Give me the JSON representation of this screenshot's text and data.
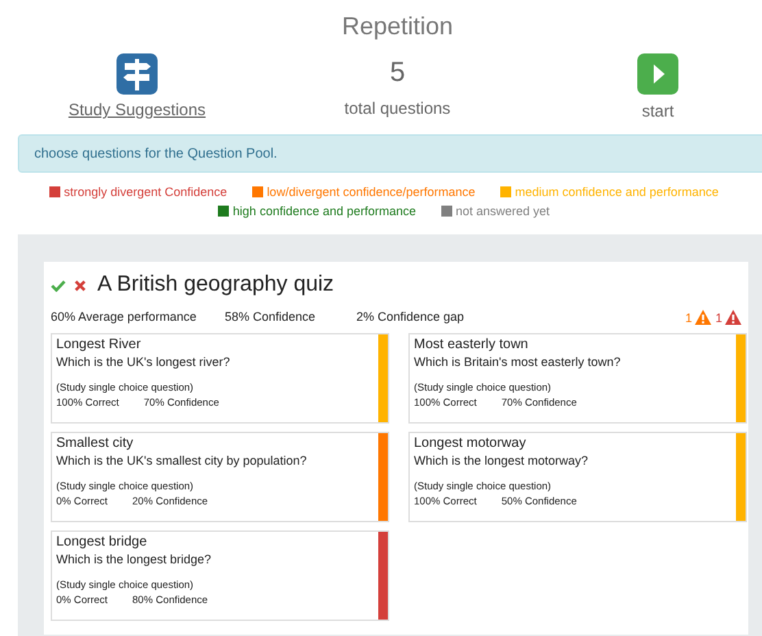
{
  "title": "Repetition",
  "actions": {
    "suggestions": "Study Suggestions",
    "count": "5",
    "count_label": "total questions",
    "start": "start"
  },
  "info": "choose questions for the Question Pool.",
  "legend": [
    {
      "label": "strongly divergent Confidence",
      "color": "#d43f3a"
    },
    {
      "label": "low/divergent confidence/performance",
      "color": "#ff7700"
    },
    {
      "label": "medium confidence and performance",
      "color": "#ffb300"
    },
    {
      "label": "high confidence and performance",
      "color": "#1e7b1e"
    },
    {
      "label": "not answered yet",
      "color": "#808080"
    }
  ],
  "quiz": {
    "title": "A British geography quiz",
    "performance": "60% Average performance",
    "confidence": "58% Confidence",
    "gap": "2% Confidence gap",
    "warnings": [
      {
        "count": "1",
        "color": "#ff7700"
      },
      {
        "count": "1",
        "color": "#d43f3a"
      }
    ],
    "questions": [
      {
        "title": "Longest River",
        "text": "Which is the UK's longest river?",
        "type": "(Study single choice question)",
        "correct": "100% Correct",
        "confidence": "70% Confidence",
        "color": "#ffb300"
      },
      {
        "title": "Most easterly town",
        "text": "Which is Britain's most easterly town?",
        "type": "(Study single choice question)",
        "correct": "100% Correct",
        "confidence": "70% Confidence",
        "color": "#ffb300"
      },
      {
        "title": "Smallest city",
        "text": "Which is the UK's smallest city by population?",
        "type": "(Study single choice question)",
        "correct": "0% Correct",
        "confidence": "20% Confidence",
        "color": "#ff7700"
      },
      {
        "title": "Longest motorway",
        "text": "Which is the longest motorway?",
        "type": "(Study single choice question)",
        "correct": "100% Correct",
        "confidence": "50% Confidence",
        "color": "#ffb300"
      },
      {
        "title": "Longest bridge",
        "text": "Which is the longest bridge?",
        "type": "(Study single choice question)",
        "correct": "0% Correct",
        "confidence": "80% Confidence",
        "color": "#d43f3a"
      }
    ]
  }
}
